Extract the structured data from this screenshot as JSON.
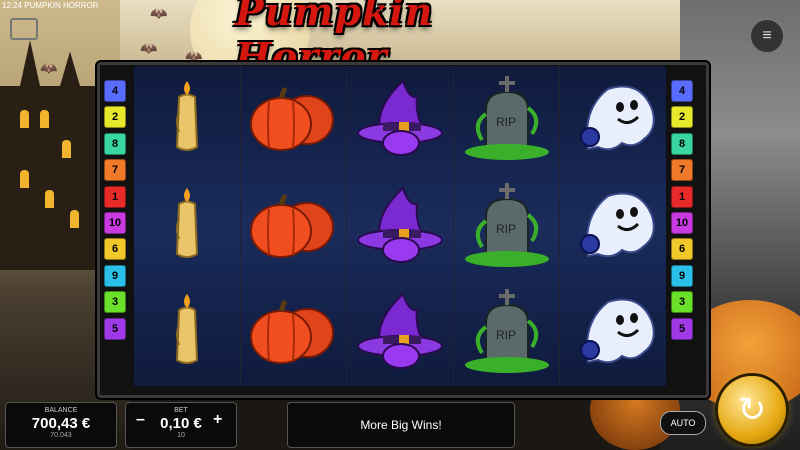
{
  "status_bar": {
    "time": "12:24",
    "app_name": "PUMPKIN HORROR"
  },
  "logo": "Pumpkin Horror",
  "paylines_left": [
    {
      "n": "4",
      "color": "#5a6cff"
    },
    {
      "n": "2",
      "color": "#e8e82a"
    },
    {
      "n": "8",
      "color": "#3ad6a0"
    },
    {
      "n": "7",
      "color": "#f07a2a"
    },
    {
      "n": "1",
      "color": "#e82a2a"
    },
    {
      "n": "10",
      "color": "#c83ae0"
    },
    {
      "n": "6",
      "color": "#f0c82a"
    },
    {
      "n": "9",
      "color": "#2ac0e8"
    },
    {
      "n": "3",
      "color": "#6ae02a"
    },
    {
      "n": "5",
      "color": "#a03ae8"
    }
  ],
  "paylines_right": [
    {
      "n": "4",
      "color": "#5a6cff"
    },
    {
      "n": "2",
      "color": "#e8e82a"
    },
    {
      "n": "8",
      "color": "#3ad6a0"
    },
    {
      "n": "7",
      "color": "#f07a2a"
    },
    {
      "n": "1",
      "color": "#e82a2a"
    },
    {
      "n": "10",
      "color": "#c83ae0"
    },
    {
      "n": "6",
      "color": "#f0c82a"
    },
    {
      "n": "9",
      "color": "#2ac0e8"
    },
    {
      "n": "3",
      "color": "#6ae02a"
    },
    {
      "n": "5",
      "color": "#a03ae8"
    }
  ],
  "reels": [
    [
      "candle-icon",
      "candle-icon",
      "candle-icon"
    ],
    [
      "pumpkin-icon",
      "pumpkin-icon",
      "pumpkin-icon"
    ],
    [
      "witch-hat-icon",
      "witch-hat-icon",
      "witch-hat-icon"
    ],
    [
      "gravestone-icon",
      "gravestone-icon",
      "gravestone-icon"
    ],
    [
      "ghost-icon",
      "ghost-icon",
      "ghost-icon"
    ]
  ],
  "balance": {
    "label": "BALANCE",
    "value": "700,43 €",
    "sub": "70.043"
  },
  "bet": {
    "label": "BET",
    "value": "0,10 €",
    "sub": "10",
    "minus": "–",
    "plus": "+"
  },
  "message": "More Big Wins!",
  "auto_label": "AUTO",
  "spin_icon": "↻",
  "menu_icon": "≡"
}
